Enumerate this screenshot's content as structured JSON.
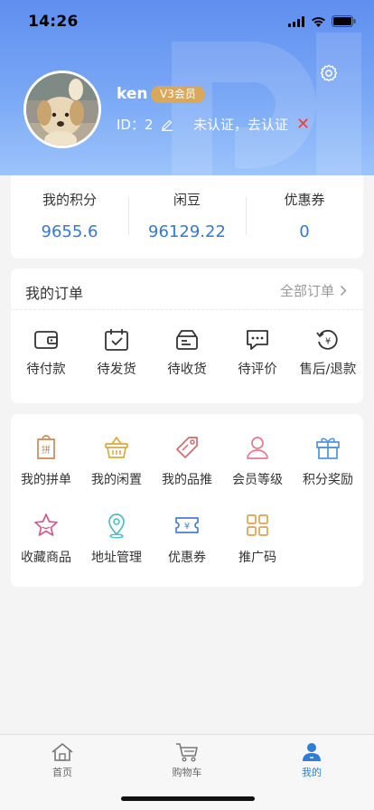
{
  "status_bar": {
    "time": "14:26"
  },
  "profile": {
    "username": "ken",
    "vip_badge": "V3会员",
    "id_label": "ID：2",
    "verify_text": "未认证，去认证",
    "verify_close": "✕"
  },
  "stats": [
    {
      "label": "我的积分",
      "value": "9655.6"
    },
    {
      "label": "闲豆",
      "value": "96129.22"
    },
    {
      "label": "优惠券",
      "value": "0"
    }
  ],
  "orders": {
    "title": "我的订单",
    "all_label": "全部订单",
    "items": [
      {
        "label": "待付款",
        "icon": "wallet-icon"
      },
      {
        "label": "待发货",
        "icon": "calendar-check-icon"
      },
      {
        "label": "待收货",
        "icon": "delivery-box-icon"
      },
      {
        "label": "待评价",
        "icon": "chat-bubble-icon"
      },
      {
        "label": "售后/退款",
        "icon": "refund-icon"
      }
    ]
  },
  "services": {
    "items": [
      {
        "label": "我的拼单",
        "icon": "group-order-icon",
        "color": "#c98a5a"
      },
      {
        "label": "我的闲置",
        "icon": "basket-icon",
        "color": "#d9a93e"
      },
      {
        "label": "我的品推",
        "icon": "tag-icon",
        "color": "#d46a6a"
      },
      {
        "label": "会员等级",
        "icon": "user-icon",
        "color": "#e27a8f"
      },
      {
        "label": "积分奖励",
        "icon": "gift-icon",
        "color": "#4f94d8"
      },
      {
        "label": "收藏商品",
        "icon": "star-icon",
        "color": "#d15a92"
      },
      {
        "label": "地址管理",
        "icon": "location-pin-icon",
        "color": "#4eb8c6"
      },
      {
        "label": "优惠券",
        "icon": "coupon-icon",
        "color": "#4a7fd0"
      },
      {
        "label": "推广码",
        "icon": "grid-icon",
        "color": "#e3a04b"
      }
    ]
  },
  "tabbar": {
    "items": [
      {
        "label": "首页",
        "icon": "home-icon"
      },
      {
        "label": "购物车",
        "icon": "cart-icon"
      },
      {
        "label": "我的",
        "icon": "profile-icon",
        "active": true
      }
    ]
  },
  "colors": {
    "header_gradient_top": "#5f8ef0",
    "header_gradient_bottom": "#9cc4fb",
    "stat_value": "#3a78c8",
    "vip_badge": "#d9a85a",
    "active_tab": "#2e7dd7"
  }
}
